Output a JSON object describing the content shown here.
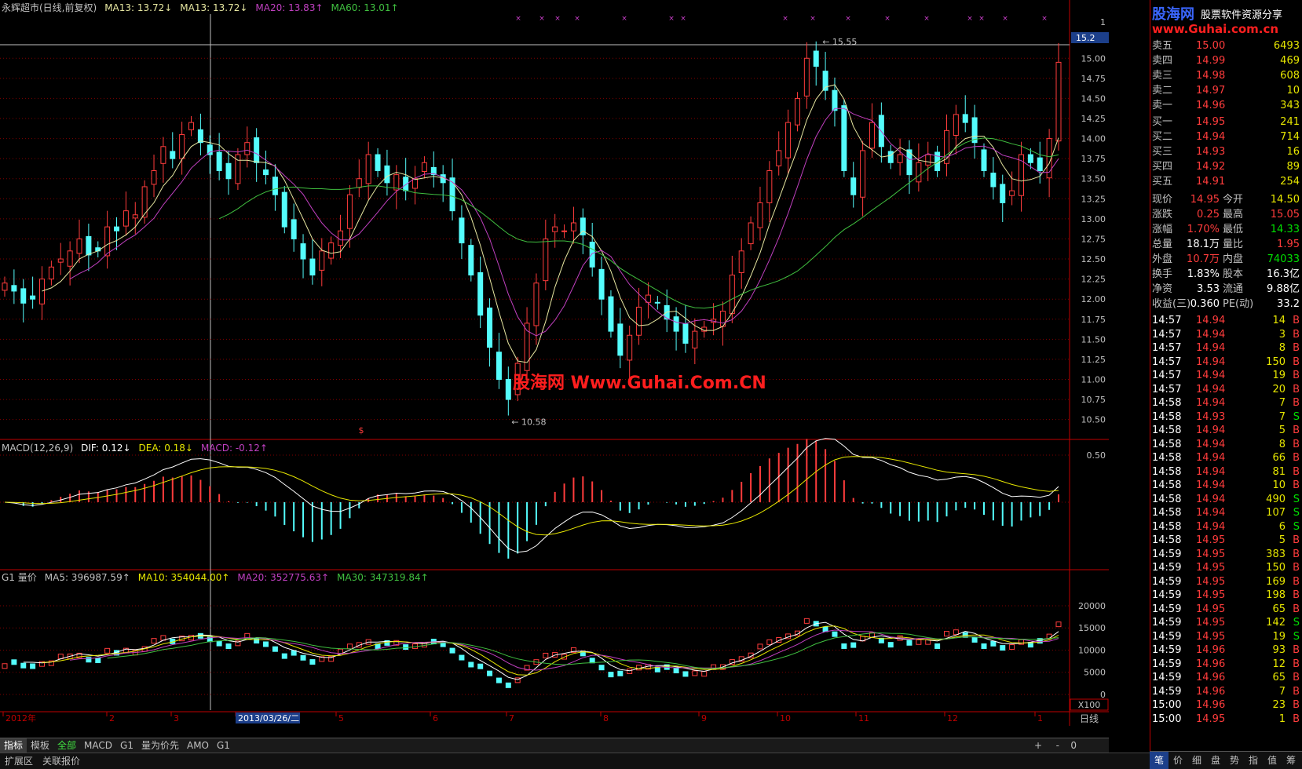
{
  "main_header": {
    "stock": "永辉超市(日线,前复权)",
    "ma13a": "MA13: 13.72↓",
    "ma13b": "MA13: 13.72↓",
    "ma20": "MA20: 13.83↑",
    "ma60": "MA60: 13.01↑"
  },
  "macd_header": {
    "name": "MACD(12,26,9)",
    "dif": "DIF: 0.12↓",
    "dea": "DEA: 0.18↓",
    "macd": "MACD: -0.12↑"
  },
  "vol_header": {
    "name": "G1 量价",
    "ma5": "MA5: 396987.59↑",
    "ma10": "MA10: 354044.00↑",
    "ma20": "MA20: 352775.63↑",
    "ma30": "MA30: 347319.84↑"
  },
  "price_axis": [
    "15.00",
    "14.75",
    "14.50",
    "14.25",
    "14.00",
    "13.75",
    "13.50",
    "13.25",
    "13.00",
    "12.75",
    "12.50",
    "12.25",
    "12.00",
    "11.75",
    "11.50",
    "11.25",
    "11.00",
    "10.75",
    "10.50"
  ],
  "price_axis_top": "1",
  "price_current_tag": "15.2",
  "macd_axis": [
    "0.50"
  ],
  "vol_axis": [
    "20000",
    "15000",
    "10000",
    "5000",
    "0"
  ],
  "vol_unit": "X100",
  "annotations": {
    "high": "15.55",
    "low": "10.58",
    "marker": "$"
  },
  "time_axis": [
    "2012年",
    "2",
    "3",
    "2013/03/26/二",
    "5",
    "6",
    "7",
    "8",
    "9",
    "10",
    "11",
    "12",
    "1"
  ],
  "period": "日线",
  "watermark": "股海网 Www.Guhai.Com.CN",
  "logo": {
    "brand": "股海网",
    "slogan": "股票软件资源分享",
    "url": "www.Guhai.com.cn"
  },
  "bottom_tabs": [
    "指标",
    "模板",
    "全部",
    "MACD",
    "G1",
    "量为价先",
    "AMO",
    "G1"
  ],
  "bottom_controls": [
    "+",
    "-",
    "0"
  ],
  "ext_tabs": [
    "扩展区",
    "关联报价"
  ],
  "rp_tabs": [
    "笔",
    "价",
    "细",
    "盘",
    "势",
    "指",
    "值",
    "筹"
  ],
  "order_book": {
    "asks": [
      {
        "label": "卖五",
        "price": "15.00",
        "vol": "6493"
      },
      {
        "label": "卖四",
        "price": "14.99",
        "vol": "469"
      },
      {
        "label": "卖三",
        "price": "14.98",
        "vol": "608"
      },
      {
        "label": "卖二",
        "price": "14.97",
        "vol": "10"
      },
      {
        "label": "卖一",
        "price": "14.96",
        "vol": "343"
      }
    ],
    "bids": [
      {
        "label": "买一",
        "price": "14.95",
        "vol": "241"
      },
      {
        "label": "买二",
        "price": "14.94",
        "vol": "714"
      },
      {
        "label": "买三",
        "price": "14.93",
        "vol": "16"
      },
      {
        "label": "买四",
        "price": "14.92",
        "vol": "89"
      },
      {
        "label": "买五",
        "price": "14.91",
        "vol": "254"
      }
    ]
  },
  "quote": [
    {
      "l1": "现价",
      "v1": "14.95",
      "l2": "今开",
      "v2": "14.50"
    },
    {
      "l1": "涨跌",
      "v1": "0.25",
      "l2": "最高",
      "v2": "15.05"
    },
    {
      "l1": "涨幅",
      "v1": "1.70%",
      "l2": "最低",
      "v2": "14.33"
    },
    {
      "l1": "总量",
      "v1": "18.1万",
      "l2": "量比",
      "v2": "1.95"
    },
    {
      "l1": "外盘",
      "v1": "10.7万",
      "l2": "内盘",
      "v2": "74033"
    },
    {
      "l1": "换手",
      "v1": "1.83%",
      "l2": "股本",
      "v2": "16.3亿"
    },
    {
      "l1": "净资",
      "v1": "3.53",
      "l2": "流通",
      "v2": "9.88亿"
    },
    {
      "l1": "收益(三)",
      "v1": "0.360",
      "l2": "PE(动)",
      "v2": "33.2"
    }
  ],
  "ticks": [
    {
      "t": "14:57",
      "p": "14.94",
      "v": "14",
      "s": "B"
    },
    {
      "t": "14:57",
      "p": "14.94",
      "v": "3",
      "s": "B"
    },
    {
      "t": "14:57",
      "p": "14.94",
      "v": "8",
      "s": "B"
    },
    {
      "t": "14:57",
      "p": "14.94",
      "v": "150",
      "s": "B"
    },
    {
      "t": "14:57",
      "p": "14.94",
      "v": "19",
      "s": "B"
    },
    {
      "t": "14:57",
      "p": "14.94",
      "v": "20",
      "s": "B"
    },
    {
      "t": "14:58",
      "p": "14.94",
      "v": "7",
      "s": "B"
    },
    {
      "t": "14:58",
      "p": "14.93",
      "v": "7",
      "s": "S"
    },
    {
      "t": "14:58",
      "p": "14.94",
      "v": "5",
      "s": "B"
    },
    {
      "t": "14:58",
      "p": "14.94",
      "v": "8",
      "s": "B"
    },
    {
      "t": "14:58",
      "p": "14.94",
      "v": "66",
      "s": "B"
    },
    {
      "t": "14:58",
      "p": "14.94",
      "v": "81",
      "s": "B"
    },
    {
      "t": "14:58",
      "p": "14.94",
      "v": "10",
      "s": "B"
    },
    {
      "t": "14:58",
      "p": "14.94",
      "v": "490",
      "s": "S"
    },
    {
      "t": "14:58",
      "p": "14.94",
      "v": "107",
      "s": "S"
    },
    {
      "t": "14:58",
      "p": "14.94",
      "v": "6",
      "s": "S"
    },
    {
      "t": "14:58",
      "p": "14.95",
      "v": "5",
      "s": "B"
    },
    {
      "t": "14:59",
      "p": "14.95",
      "v": "383",
      "s": "B"
    },
    {
      "t": "14:59",
      "p": "14.95",
      "v": "150",
      "s": "B"
    },
    {
      "t": "14:59",
      "p": "14.95",
      "v": "169",
      "s": "B"
    },
    {
      "t": "14:59",
      "p": "14.95",
      "v": "198",
      "s": "B"
    },
    {
      "t": "14:59",
      "p": "14.95",
      "v": "65",
      "s": "B"
    },
    {
      "t": "14:59",
      "p": "14.95",
      "v": "142",
      "s": "S"
    },
    {
      "t": "14:59",
      "p": "14.95",
      "v": "19",
      "s": "S"
    },
    {
      "t": "14:59",
      "p": "14.96",
      "v": "93",
      "s": "B"
    },
    {
      "t": "14:59",
      "p": "14.96",
      "v": "12",
      "s": "B"
    },
    {
      "t": "14:59",
      "p": "14.96",
      "v": "65",
      "s": "B"
    },
    {
      "t": "14:59",
      "p": "14.96",
      "v": "7",
      "s": "B"
    },
    {
      "t": "15:00",
      "p": "14.96",
      "v": "23",
      "s": "B"
    },
    {
      "t": "15:00",
      "p": "14.95",
      "v": "1",
      "s": "B"
    }
  ],
  "colors": {
    "up": "#ff3c3c",
    "down": "#54fcfc",
    "ma13": "#e6e6a0",
    "ma20": "#c040c0",
    "ma60": "#40c040",
    "grid": "#800000",
    "border": "#c00000"
  },
  "chart_data": {
    "type": "candlestick",
    "start_close": 12.2,
    "closes": [
      12.2,
      12.1,
      11.95,
      12.0,
      12.25,
      12.4,
      12.5,
      12.6,
      12.75,
      12.55,
      12.6,
      12.9,
      12.85,
      13.1,
      13.05,
      13.4,
      13.6,
      13.9,
      13.75,
      14.05,
      14.2,
      13.95,
      13.8,
      13.6,
      13.5,
      13.8,
      13.95,
      13.7,
      13.55,
      13.3,
      12.9,
      12.75,
      12.5,
      12.3,
      12.6,
      12.7,
      12.85,
      13.3,
      13.5,
      13.8,
      13.6,
      13.45,
      13.55,
      13.35,
      13.5,
      13.7,
      13.55,
      13.45,
      13.1,
      12.7,
      12.3,
      11.8,
      11.4,
      11.0,
      10.75,
      11.2,
      11.7,
      12.2,
      12.75,
      12.9,
      12.85,
      12.95,
      12.8,
      12.4,
      12.0,
      11.6,
      11.3,
      11.55,
      11.9,
      12.05,
      11.95,
      11.75,
      11.6,
      11.45,
      11.6,
      11.65,
      11.75,
      11.85,
      12.3,
      12.6,
      12.95,
      13.2,
      13.6,
      13.85,
      14.2,
      14.5,
      15.0,
      14.9,
      14.6,
      14.35,
      13.6,
      13.3,
      13.85,
      14.2,
      13.9,
      13.7,
      13.8,
      13.55,
      13.7,
      13.8,
      13.6,
      14.1,
      14.3,
      14.2,
      13.95,
      13.6,
      13.4,
      13.2,
      13.35,
      13.8,
      13.7,
      13.6,
      14.0,
      14.95
    ],
    "volume_unit": "X100"
  }
}
